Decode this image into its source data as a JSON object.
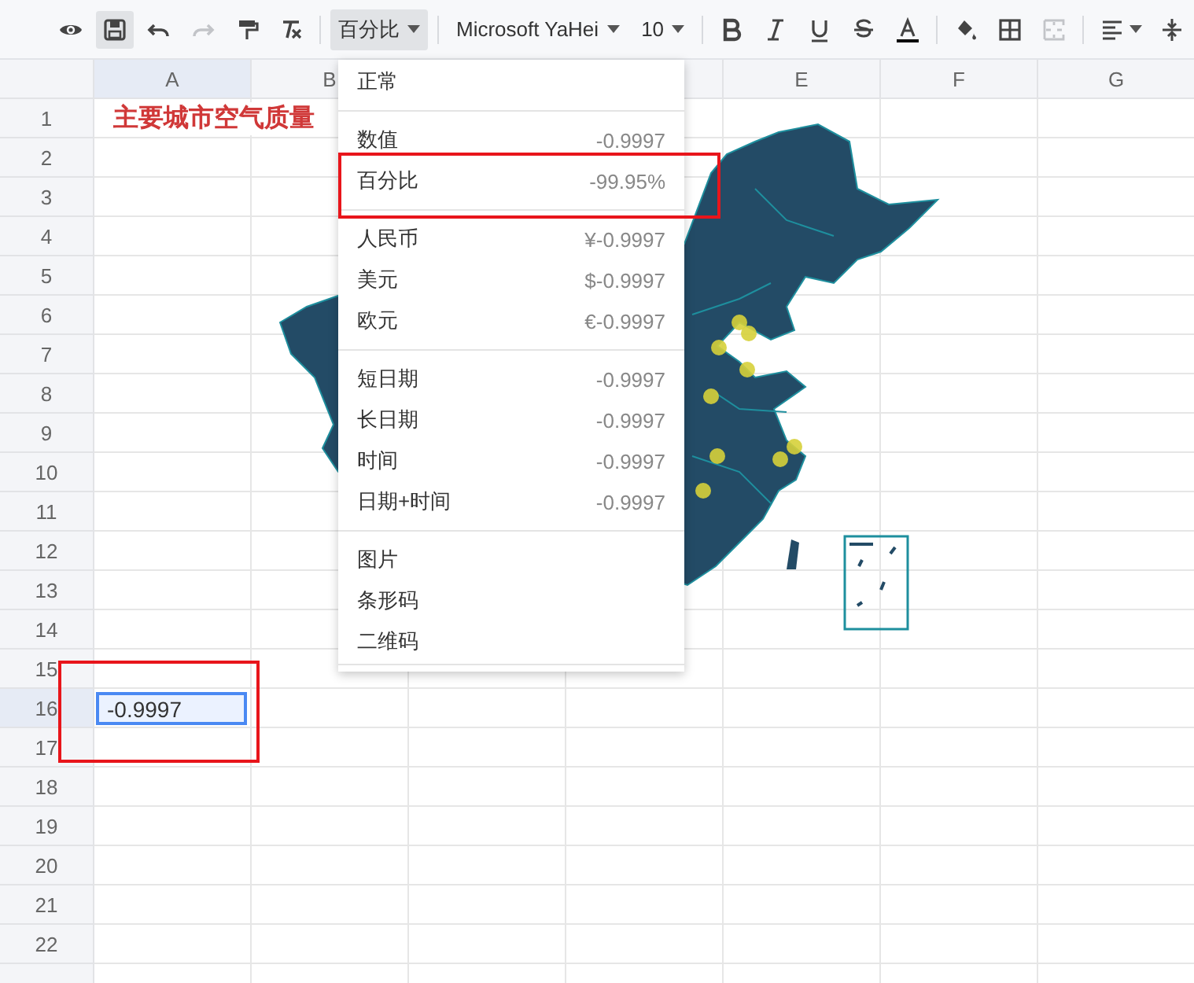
{
  "toolbar": {
    "groups": [
      [
        {
          "kind": "preview",
          "selected": false,
          "disabled": false
        },
        {
          "kind": "save",
          "selected": true,
          "disabled": false
        },
        {
          "kind": "undo",
          "selected": false,
          "disabled": false
        },
        {
          "kind": "redo",
          "selected": false,
          "disabled": true
        },
        {
          "kind": "paint-format",
          "selected": false,
          "disabled": false
        },
        {
          "kind": "clear-format",
          "selected": false,
          "disabled": false
        }
      ],
      [
        {
          "kind": "dropdown",
          "label": "百分比",
          "selected": true,
          "disabled": false
        }
      ],
      [
        {
          "kind": "dropdown",
          "label": "Microsoft YaHei",
          "selected": false,
          "disabled": false
        },
        {
          "kind": "dropdown",
          "label": "10",
          "selected": false,
          "disabled": false
        }
      ],
      [
        {
          "kind": "bold",
          "selected": false,
          "disabled": false
        },
        {
          "kind": "italic",
          "selected": false,
          "disabled": false
        },
        {
          "kind": "underline",
          "selected": false,
          "disabled": false
        },
        {
          "kind": "strikethrough",
          "selected": false,
          "disabled": false
        },
        {
          "kind": "text-color",
          "selected": false,
          "disabled": false,
          "color": "#000000"
        }
      ],
      [
        {
          "kind": "fill-color",
          "selected": false,
          "disabled": false
        },
        {
          "kind": "borders",
          "selected": false,
          "disabled": false
        },
        {
          "kind": "merge",
          "selected": false,
          "disabled": true
        }
      ],
      [
        {
          "kind": "align",
          "selected": false,
          "disabled": false
        },
        {
          "kind": "vertical-align",
          "selected": false,
          "disabled": false
        }
      ]
    ]
  },
  "sheet": {
    "columns": [
      {
        "label": "A",
        "selected": true
      },
      {
        "label": "B",
        "selected": false
      },
      {},
      {},
      {
        "label": "E",
        "selected": false
      },
      {
        "label": "F",
        "selected": false
      },
      {
        "label": "G",
        "selected": false
      }
    ],
    "rows": [
      {
        "label": "1",
        "selected": false,
        "cells": [
          {
            "kind": "title",
            "text": "主要城市空气质量"
          }
        ]
      },
      {
        "label": "2",
        "selected": false
      },
      {
        "label": "3",
        "selected": false
      },
      {
        "label": "4",
        "selected": false
      },
      {
        "label": "5",
        "selected": false
      },
      {
        "label": "6",
        "selected": false
      },
      {
        "label": "7",
        "selected": false
      },
      {
        "label": "8",
        "selected": false
      },
      {
        "label": "9",
        "selected": false
      },
      {
        "label": "10",
        "selected": false
      },
      {
        "label": "11",
        "selected": false
      },
      {
        "label": "12",
        "selected": false
      },
      {
        "label": "13",
        "selected": false
      },
      {
        "label": "14",
        "selected": false
      },
      {
        "label": "15",
        "selected": false
      },
      {
        "label": "16",
        "selected": true,
        "cells": [
          {
            "kind": "value",
            "text": "-0.9997",
            "selected": true
          }
        ]
      },
      {
        "label": "17",
        "selected": false
      },
      {
        "label": "18",
        "selected": false
      },
      {
        "label": "19",
        "selected": false
      },
      {
        "label": "20",
        "selected": false
      },
      {
        "label": "21",
        "selected": false
      },
      {
        "label": "22",
        "selected": false
      }
    ]
  },
  "format_menu": {
    "sections": [
      [
        {
          "label": "正常"
        }
      ],
      [
        {
          "label": "数值",
          "sample": "-0.9997"
        },
        {
          "label": "百分比",
          "sample": "-99.95%"
        }
      ],
      [
        {
          "label": "人民币",
          "sample": "¥-0.9997"
        },
        {
          "label": "美元",
          "sample": "$-0.9997"
        },
        {
          "label": "欧元",
          "sample": "€-0.9997"
        }
      ],
      [
        {
          "label": "短日期",
          "sample": "-0.9997"
        },
        {
          "label": "长日期",
          "sample": "-0.9997"
        },
        {
          "label": "时间",
          "sample": "-0.9997"
        },
        {
          "label": "日期+时间",
          "sample": "-0.9997"
        }
      ],
      [
        {
          "label": "图片"
        },
        {
          "label": "条形码"
        },
        {
          "label": "二维码"
        }
      ]
    ]
  }
}
